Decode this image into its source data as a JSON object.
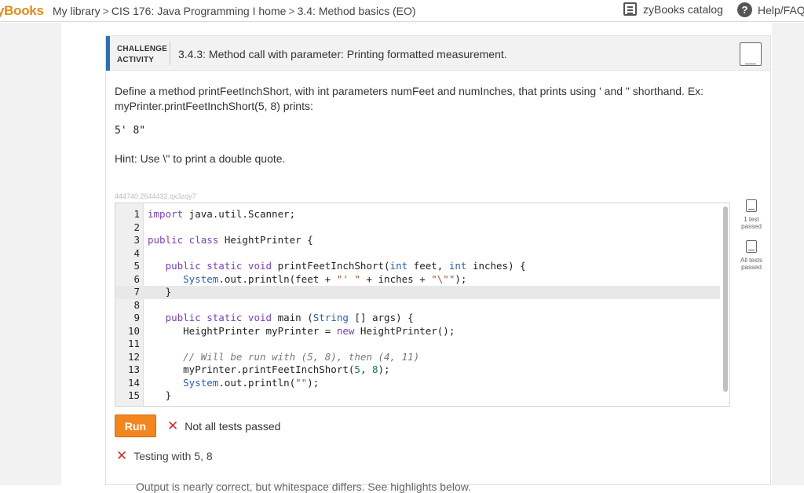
{
  "topbar": {
    "brand": "yBooks",
    "breadcrumbs": [
      "My library",
      "CIS 176: Java Programming I home",
      "3.4: Method basics (EO)"
    ],
    "separator": ">",
    "catalog_label": "zyBooks catalog",
    "help_label": "Help/FAQ"
  },
  "activity": {
    "tag_line1": "CHALLENGE",
    "tag_line2": "ACTIVITY",
    "title": "3.4.3: Method call with parameter: Printing formatted measurement.",
    "description": "Define a method printFeetInchShort, with int parameters numFeet and numInches, that prints using ' and \" shorthand. Ex: myPrinter.printFeetInchShort(5, 8) prints:",
    "example_output": "5' 8\"",
    "hint": "Hint: Use \\\" to print a double quote.",
    "serial": "444740.2644432.qx3zqy7"
  },
  "editor": {
    "line_numbers": [
      "1",
      "2",
      "3",
      "4",
      "5",
      "6",
      "7",
      "8",
      "9",
      "10",
      "11",
      "12",
      "13",
      "14",
      "15"
    ]
  },
  "tests": {
    "first_label": "1 test passed",
    "all_label": "All tests passed"
  },
  "run": {
    "button_label": "Run",
    "status": "Not all tests passed",
    "testing": "Testing with 5, 8",
    "cut_text": "Output is nearly correct, but whitespace differs. See highlights below."
  },
  "colors": {
    "brand": "#e08b1e",
    "accent_bar": "#2f6db5",
    "run_button": "#f4861f",
    "error": "#d32f2f"
  },
  "icons": {
    "catalog": "book-icon",
    "help": "help-icon",
    "fail": "x-icon"
  }
}
